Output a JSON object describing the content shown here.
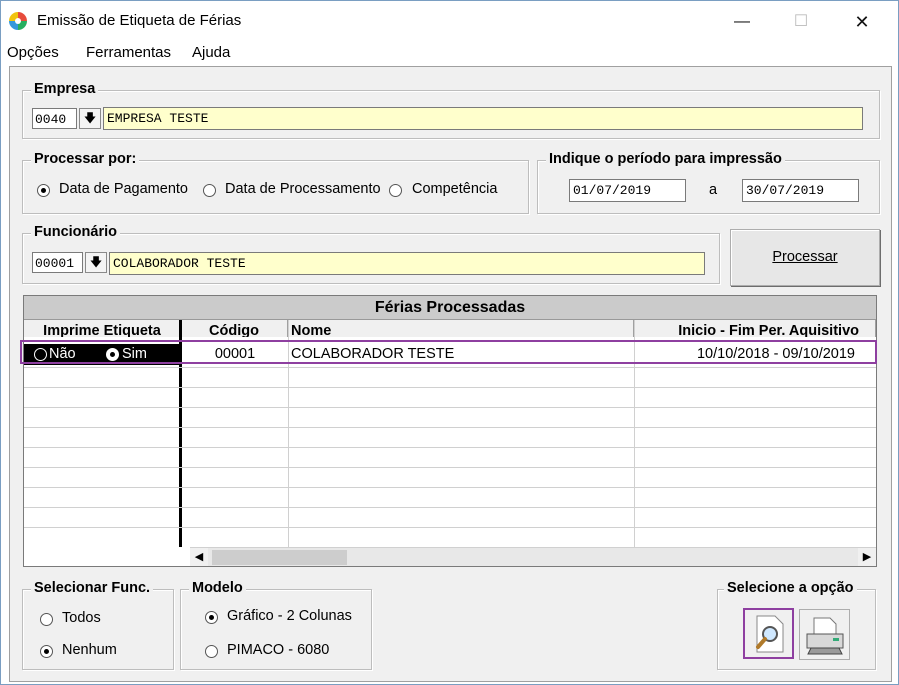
{
  "window": {
    "title": "Emissão de Etiqueta de Férias",
    "minimize": "—",
    "maximize": "☐",
    "close": "✕"
  },
  "menu": [
    "Opções",
    "Ferramentas",
    "Ajuda"
  ],
  "empresa": {
    "label": "Empresa",
    "code": "0040",
    "name": "EMPRESA TESTE"
  },
  "processar_por": {
    "label": "Processar por:",
    "options": [
      "Data de Pagamento",
      "Data de Processamento",
      "Competência"
    ],
    "selected": "Data de Pagamento"
  },
  "periodo": {
    "label": "Indique o período para impressão",
    "start": "01/07/2019",
    "sep": "a",
    "end": "30/07/2019"
  },
  "funcionario": {
    "label": "Funcionário",
    "code": "00001",
    "name": "COLABORADOR TESTE"
  },
  "processar_button": "Processar",
  "grid": {
    "title": "Férias Processadas",
    "columns": [
      "Imprime Etiqueta",
      "Código",
      "Nome",
      "Inicio - Fim Per. Aquisitivo"
    ],
    "rows": [
      {
        "nao": "Não",
        "sim": "Sim",
        "codigo": "00001",
        "nome": "COLABORADOR TESTE",
        "periodo": "10/10/2018 - 09/10/2019"
      }
    ]
  },
  "selecionar_func": {
    "label": "Selecionar Func.",
    "options": [
      "Todos",
      "Nenhum"
    ],
    "selected": "Nenhum"
  },
  "modelo": {
    "label": "Modelo",
    "options": [
      "Gráfico - 2 Colunas",
      "PIMACO - 6080"
    ],
    "selected": "Gráfico - 2 Colunas"
  },
  "selecione_opcao": {
    "label": "Selecione a opção"
  }
}
